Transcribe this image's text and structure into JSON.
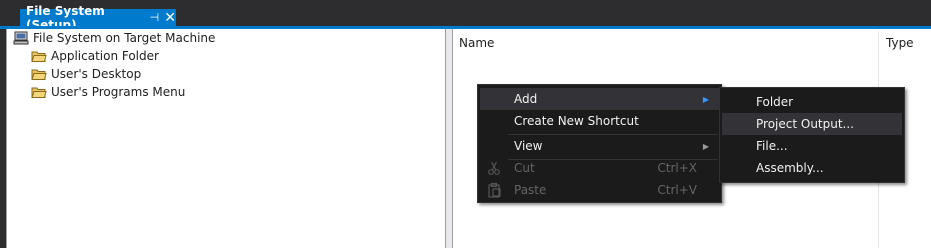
{
  "tab": {
    "title": "File System (Setup)",
    "pin_glyph": "⊣",
    "close_glyph": "✕"
  },
  "tree": {
    "root": {
      "label": "File System on Target Machine",
      "icon": "computer-icon"
    },
    "items": [
      {
        "label": "Application Folder",
        "icon": "folder-icon"
      },
      {
        "label": "User's Desktop",
        "icon": "folder-icon"
      },
      {
        "label": "User's Programs Menu",
        "icon": "folder-icon"
      }
    ]
  },
  "list": {
    "columns": [
      "Name",
      "Type"
    ]
  },
  "context_menu": {
    "items": [
      {
        "label": "Add",
        "has_submenu": true,
        "highlighted": true
      },
      {
        "label": "Create New Shortcut"
      },
      {
        "label": "View",
        "has_submenu": true
      },
      {
        "label": "Cut",
        "shortcut": "Ctrl+X",
        "disabled": true,
        "icon": "scissors-icon"
      },
      {
        "label": "Paste",
        "shortcut": "Ctrl+V",
        "disabled": true,
        "icon": "clipboard-icon"
      }
    ],
    "arrow_glyph": "▶"
  },
  "submenu": {
    "items": [
      {
        "label": "Folder"
      },
      {
        "label": "Project Output...",
        "highlighted": true
      },
      {
        "label": "File..."
      },
      {
        "label": "Assembly..."
      }
    ]
  },
  "colors": {
    "accent": "#007acc",
    "menu_bg": "#1b1b1c",
    "menu_highlight": "#333337",
    "menu_text": "#f1f1f1",
    "menu_disabled": "#656565"
  }
}
